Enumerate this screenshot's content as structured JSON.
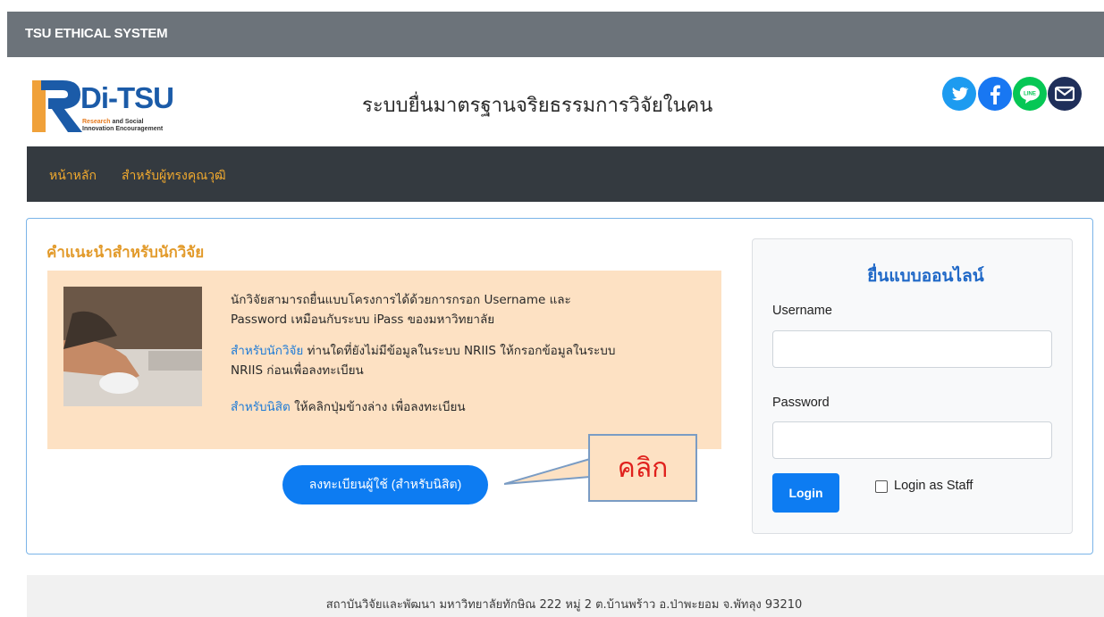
{
  "topbar": {
    "title": "TSU ETHICAL SYSTEM"
  },
  "header": {
    "logo": {
      "name": "Di-TSU",
      "sub_highlight": "Research",
      "sub_line1": " and Social",
      "sub_line2": "Innovation Encouragement"
    },
    "site_title": "ระบบยื่นมาตรฐานจริยธรรมการวิจัยในคน",
    "social": [
      {
        "icon": "twitter-icon",
        "color": "#1d9bf0"
      },
      {
        "icon": "facebook-icon",
        "color": "#1877f2"
      },
      {
        "icon": "line-icon",
        "color": "#06c755",
        "text": "LINE"
      },
      {
        "icon": "mail-icon",
        "color": "#1f2f5a"
      }
    ]
  },
  "nav": {
    "items": [
      {
        "label": "หน้าหลัก"
      },
      {
        "label": "สำหรับผู้ทรงคุณวุฒิ"
      }
    ]
  },
  "guide": {
    "title": "คำแนะนำสำหรับนักวิจัย",
    "para1_line1": "นักวิจัยสามารถยื่นแบบโครงการได้ด้วยการกรอก Username และ",
    "para1_line2": "Password เหมือนกับระบบ iPass ของมหาวิทยาลัย",
    "para2_link": "สำหรับนักวิจัย",
    "para2_line1_rest": " ท่านใดที่ยังไม่มีข้อมูลในระบบ NRIIS ให้กรอกข้อมูลในระบบ",
    "para2_line2": "NRIIS ก่อนเพื่อลงทะเบียน",
    "para3_link": "สำหรับนิสิต",
    "para3_rest": " ให้คลิกปุ่มข้างล่าง เพื่อลงทะเบียน",
    "register_button": "ลงทะเบียนผู้ใช้ (สำหรับนิสิต)"
  },
  "callout": {
    "text": "คลิก"
  },
  "login": {
    "title": "ยื่นแบบออนไลน์",
    "username_label": "Username",
    "username_value": "",
    "password_label": "Password",
    "password_value": "",
    "login_button": "Login",
    "staff_label": "Login as Staff",
    "staff_checked": false
  },
  "footer": {
    "text": "สถาบันวิจัยและพัฒนา มหาวิทยาลัยทักษิณ 222 หมู่ 2 ต.บ้านพร้าว อ.ป่าพะยอม จ.พัทลุง 93210"
  }
}
